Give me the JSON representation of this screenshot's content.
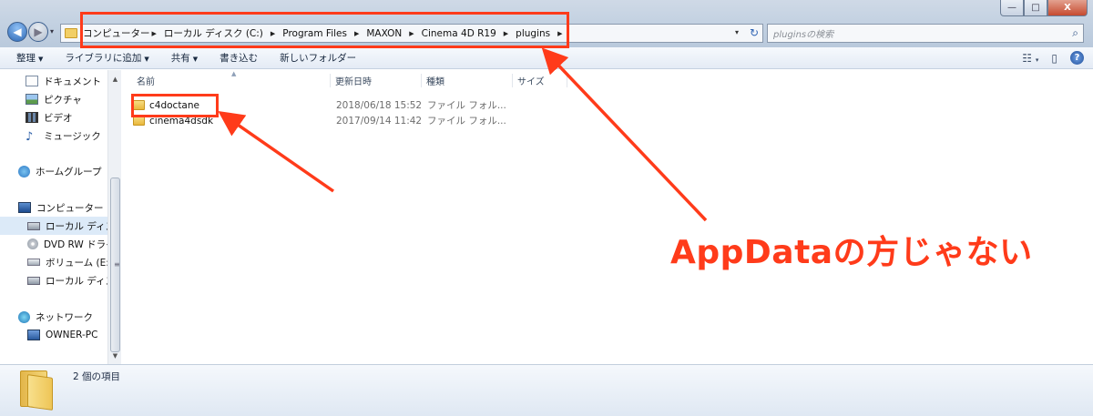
{
  "window": {
    "controls": {
      "minimize": "—",
      "maximize": "□",
      "close": "X"
    }
  },
  "navigation": {
    "back_icon": "back-arrow-icon",
    "forward_icon": "forward-arrow-icon",
    "back_glyph": "◀",
    "forward_glyph": "▶",
    "recent_dropdown": "▾"
  },
  "address_bar": {
    "breadcrumbs": [
      "コンピューター",
      "ローカル ディスク (C:)",
      "Program Files",
      "MAXON",
      "Cinema 4D R19",
      "plugins"
    ],
    "separator": "▶",
    "dropdown": "▾",
    "refresh": "↻"
  },
  "search": {
    "placeholder": "pluginsの検索",
    "icon": "⌕"
  },
  "toolbar": {
    "items": [
      {
        "label": "整理",
        "has_dropdown": true
      },
      {
        "label": "ライブラリに追加",
        "has_dropdown": true
      },
      {
        "label": "共有",
        "has_dropdown": true
      },
      {
        "label": "書き込む",
        "has_dropdown": false
      },
      {
        "label": "新しいフォルダー",
        "has_dropdown": false
      }
    ],
    "dropdown_glyph": "▼",
    "view_icon": "☷",
    "view_dropdown": "▾",
    "preview_icon": "▯",
    "help": "?"
  },
  "nav_pane": {
    "items": [
      {
        "label": "ドキュメント",
        "icon": "document-icon"
      },
      {
        "label": "ピクチャ",
        "icon": "pictures-icon"
      },
      {
        "label": "ビデオ",
        "icon": "videos-icon"
      },
      {
        "label": "ミュージック",
        "icon": "music-icon"
      },
      {
        "label": "ホームグループ",
        "icon": "homegroup-icon"
      },
      {
        "label": "コンピューター",
        "icon": "computer-icon"
      },
      {
        "label": "ローカル ディスク",
        "icon": "local-disk-icon",
        "selected": true
      },
      {
        "label": "DVD RW ドライ",
        "icon": "dvd-drive-icon"
      },
      {
        "label": "ボリューム (E:)",
        "icon": "volume-icon"
      },
      {
        "label": "ローカル ディスク",
        "icon": "local-disk-icon"
      },
      {
        "label": "ネットワーク",
        "icon": "network-icon"
      },
      {
        "label": "OWNER-PC",
        "icon": "pc-icon"
      }
    ],
    "music_glyph": "♪",
    "scroll_up": "▲",
    "scroll_down": "▼",
    "grip": "≡"
  },
  "file_list": {
    "columns": [
      "名前",
      "更新日時",
      "種類",
      "サイズ"
    ],
    "sort_glyph": "▲",
    "rows": [
      {
        "name": "c4doctane",
        "modified": "2018/06/18 15:52",
        "type": "ファイル フォル...",
        "size": ""
      },
      {
        "name": "cinema4dsdk",
        "modified": "2017/09/14 11:42",
        "type": "ファイル フォル...",
        "size": ""
      }
    ]
  },
  "details_pane": {
    "item_count": "2 個の項目"
  },
  "annotation": {
    "callout_text": "AppDataの方じゃない",
    "color": "#ff3b1a"
  }
}
